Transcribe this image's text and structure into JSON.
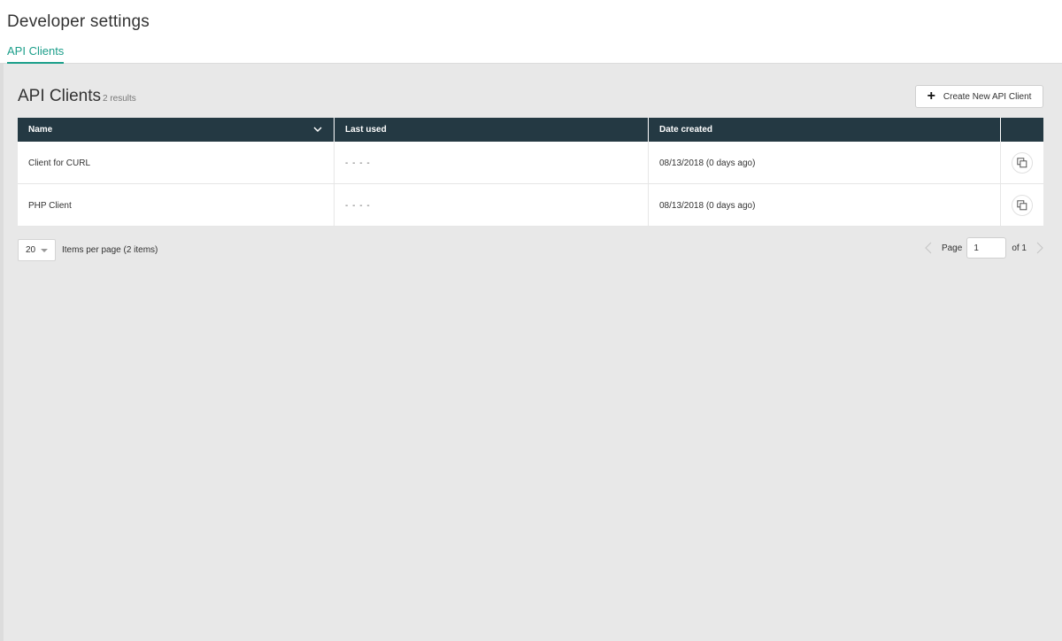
{
  "header": {
    "title": "Developer settings",
    "tabs": [
      {
        "label": "API Clients",
        "active": true
      }
    ]
  },
  "section": {
    "title": "API Clients",
    "count_text": "2 results",
    "create_button_label": "Create New API Client"
  },
  "table": {
    "columns": [
      "Name",
      "Last used",
      "Date created"
    ],
    "rows": [
      {
        "name": "Client for CURL",
        "last_used": "- - - -",
        "date_created": "08/13/2018 (0 days ago)"
      },
      {
        "name": "PHP Client",
        "last_used": "- - - -",
        "date_created": "08/13/2018 (0 days ago)"
      }
    ]
  },
  "pagination": {
    "per_page_value": "20",
    "per_page_label": "Items per page (2 items)",
    "page_label": "Page",
    "page_value": "1",
    "of_label": "of 1"
  },
  "colors": {
    "accent": "#1b9e8a",
    "table_header": "#243943",
    "background": "#e8e8e8"
  },
  "icons": [
    "plus-icon",
    "chevron-down-icon",
    "copy-icon",
    "chevron-left-icon",
    "chevron-right-icon",
    "caret-down-icon"
  ]
}
